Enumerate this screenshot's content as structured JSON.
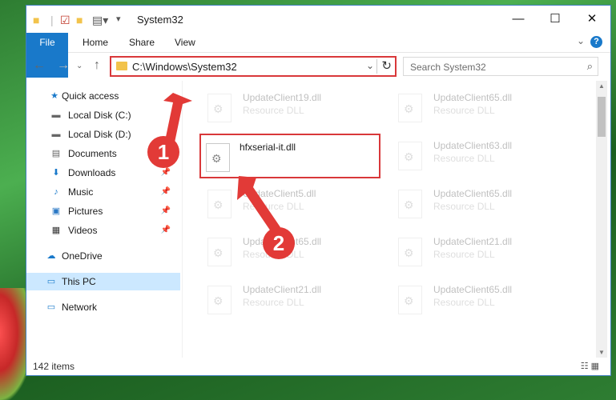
{
  "window": {
    "title": "System32",
    "controls": {
      "minimize": "—",
      "maximize": "☐",
      "close": "✕"
    }
  },
  "ribbon": {
    "tabs": [
      "File",
      "Home",
      "Share",
      "View"
    ],
    "help": "?"
  },
  "address": {
    "path": "C:\\Windows\\System32"
  },
  "search": {
    "placeholder": "Search System32"
  },
  "sidebar": {
    "items": [
      {
        "label": "Quick access",
        "icon": "star-icon"
      },
      {
        "label": "Local Disk (C:)",
        "icon": "drive-icon"
      },
      {
        "label": "Local Disk (D:)",
        "icon": "drive-icon"
      },
      {
        "label": "Documents",
        "icon": "documents-icon"
      },
      {
        "label": "Downloads",
        "icon": "download-icon"
      },
      {
        "label": "Music",
        "icon": "music-icon"
      },
      {
        "label": "Pictures",
        "icon": "pictures-icon"
      },
      {
        "label": "Videos",
        "icon": "videos-icon"
      },
      {
        "label": "OneDrive",
        "icon": "cloud-icon"
      },
      {
        "label": "This PC",
        "icon": "computer-icon"
      },
      {
        "label": "Network",
        "icon": "network-icon"
      }
    ]
  },
  "files": {
    "left": [
      {
        "name": "UpdateClient19.dll",
        "type": "Resource DLL"
      },
      {
        "name": "hfxserial-it.dll",
        "type": ""
      },
      {
        "name": "UpdateClient5.dll",
        "type": "Resource DLL"
      },
      {
        "name": "UpdateClient65.dll",
        "type": "Resource DLL"
      },
      {
        "name": "UpdateClient21.dll",
        "type": "Resource DLL"
      }
    ],
    "right": [
      {
        "name": "UpdateClient65.dll",
        "type": "Resource DLL"
      },
      {
        "name": "UpdateClient63.dll",
        "type": "Resource DLL"
      },
      {
        "name": "UpdateClient65.dll",
        "type": "Resource DLL"
      },
      {
        "name": "UpdateClient21.dll",
        "type": "Resource DLL"
      },
      {
        "name": "UpdateClient65.dll",
        "type": "Resource DLL"
      }
    ]
  },
  "status": {
    "count": "142 items"
  },
  "callouts": [
    "1",
    "2"
  ],
  "colors": {
    "accent": "#1979ca",
    "highlight": "#d9383a",
    "selected": "#cce8ff"
  }
}
